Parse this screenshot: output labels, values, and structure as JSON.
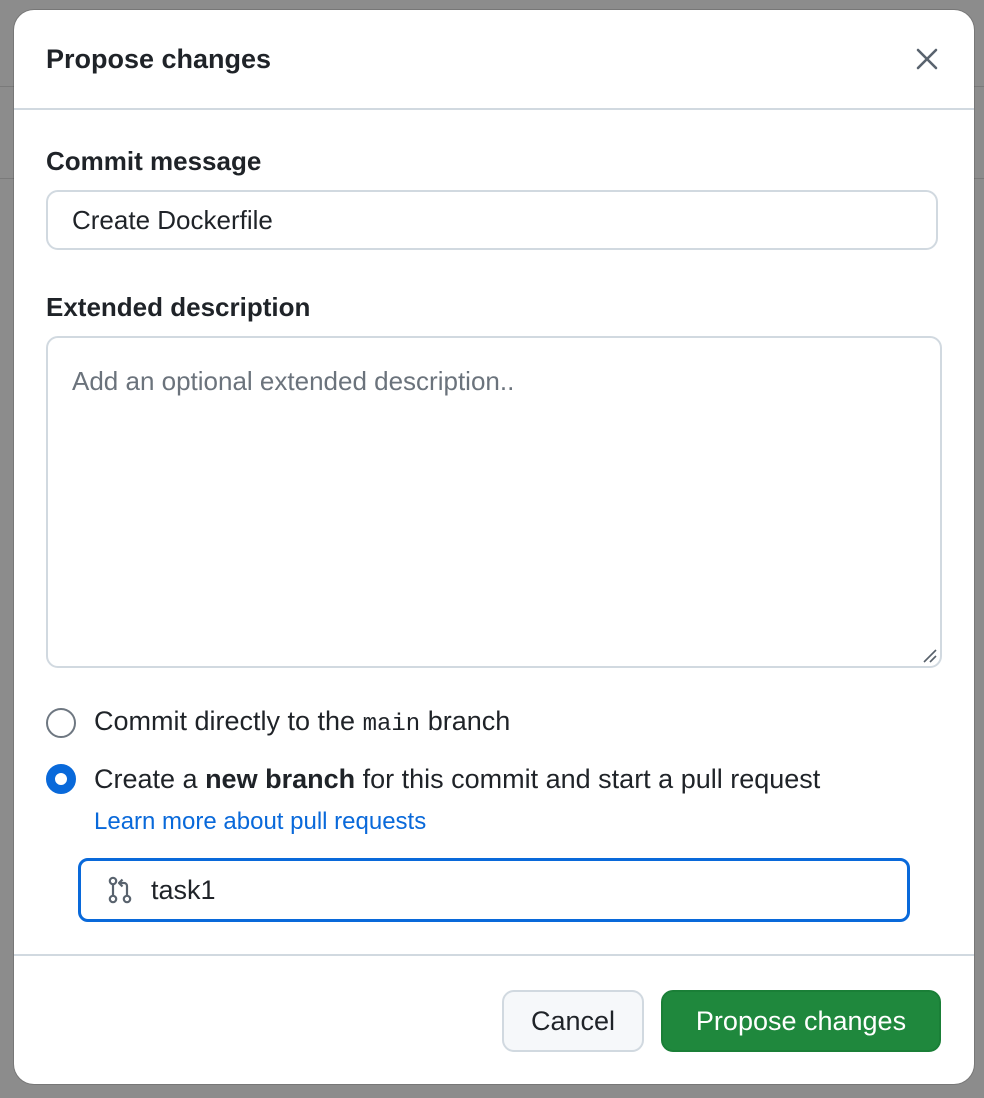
{
  "dialog": {
    "title": "Propose changes",
    "close_icon": "close-icon"
  },
  "commit_message": {
    "label": "Commit message",
    "value": "Create Dockerfile"
  },
  "extended_description": {
    "label": "Extended description",
    "placeholder": "Add an optional extended description.."
  },
  "options": {
    "direct": {
      "prefix": "Commit directly to the ",
      "branch": "main",
      "suffix": " branch",
      "checked": false
    },
    "new_branch": {
      "prefix": "Create a ",
      "bold": "new branch",
      "suffix": " for this commit and start a pull request",
      "checked": true
    },
    "learn_more": "Learn more about pull requests"
  },
  "branch_name": {
    "value": "task1",
    "icon": "git-pull-request-icon"
  },
  "footer": {
    "cancel_label": "Cancel",
    "submit_label": "Propose changes"
  },
  "colors": {
    "primary_button": "#1f883d",
    "accent": "#0969da",
    "border": "#d1d9e0",
    "text": "#1f2328"
  }
}
